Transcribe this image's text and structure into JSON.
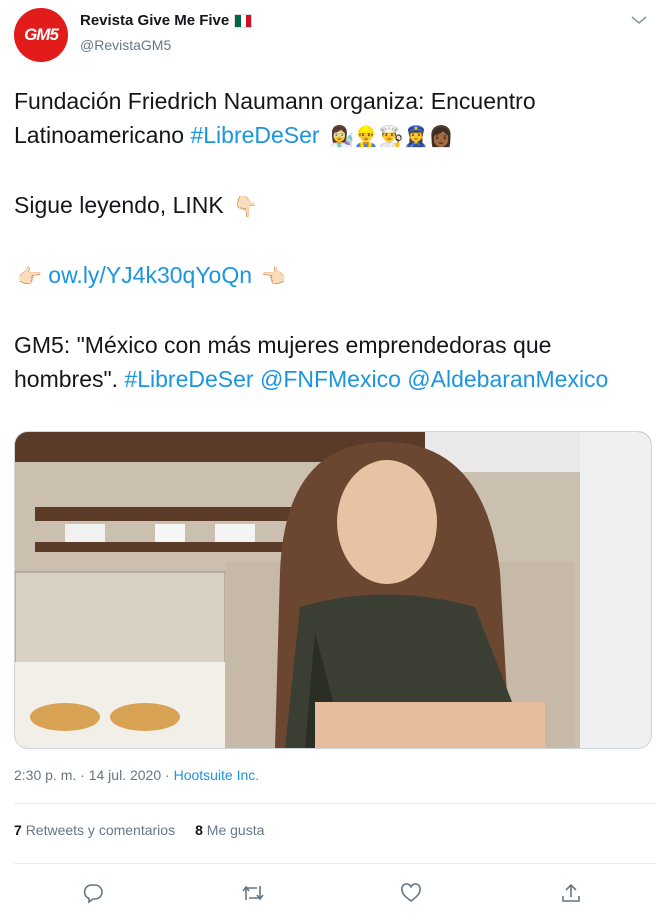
{
  "author": {
    "name": "Revista Give Me Five",
    "handle": "@RevistaGM5",
    "avatar_text": "GM5",
    "flag_colors": [
      "#006847",
      "#ffffff",
      "#ce1126"
    ]
  },
  "tweet": {
    "line1": "Fundación Friedrich Naumann organiza: Encuentro Latinoamericano ",
    "hashtag1": "#LibreDeSer",
    "line1_emojis": "👩‍🔬👷‍♂️👨‍🍳👮‍♀️👩🏾",
    "line2": "Sigue leyendo, LINK ",
    "line2_emoji": "👇🏻",
    "link_left_emoji": "👉🏻",
    "link": "ow.ly/YJ4k30qYoQn",
    "link_right_emoji": "👈🏻",
    "line4_prefix": "GM5: \"México con más mujeres emprendedoras que hombres\". ",
    "hashtag2": "#LibreDeSer",
    "mention1": "@FNFMexico",
    "mention2": "@AldebaranMexico"
  },
  "meta": {
    "time": "2:30 p. m.",
    "separator": "·",
    "date": "14 jul. 2020",
    "source": "Hootsuite Inc."
  },
  "stats": {
    "retweets_count": "7",
    "retweets_label": "Retweets y comentarios",
    "likes_count": "8",
    "likes_label": "Me gusta"
  },
  "colors": {
    "link": "#1b95e0",
    "muted": "#657786",
    "text": "#14171a",
    "brand": "#e21b1b"
  }
}
